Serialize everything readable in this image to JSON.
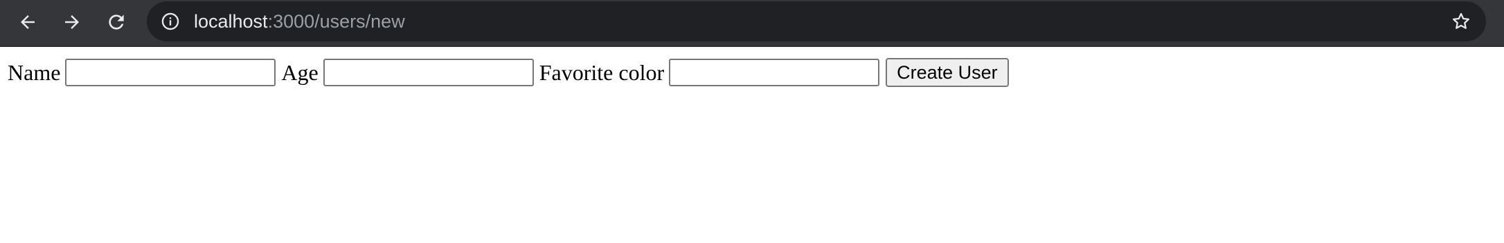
{
  "browser": {
    "url_host": "localhost",
    "url_path": ":3000/users/new",
    "icons": {
      "back": "arrow-left",
      "forward": "arrow-right",
      "reload": "reload",
      "site_info": "info",
      "bookmark": "star"
    },
    "colors": {
      "toolbar_bg": "#35363a",
      "omnibox_bg": "#202124",
      "url_host": "#e8eaed",
      "url_path": "#9aa0a6"
    }
  },
  "form": {
    "fields": [
      {
        "label": "Name",
        "value": ""
      },
      {
        "label": "Age",
        "value": ""
      },
      {
        "label": "Favorite color",
        "value": ""
      }
    ],
    "submit_label": "Create User"
  }
}
